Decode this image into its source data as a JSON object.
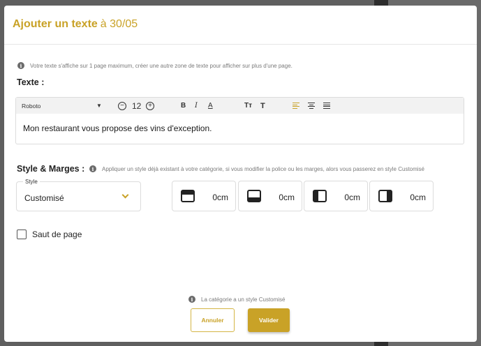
{
  "modal": {
    "title_bold": "Ajouter un texte",
    "title_date": "à 30/05"
  },
  "info_text": "Votre texte s'affiche sur 1 page maximum, créer une autre zone de texte pour afficher sur plus d'une page.",
  "texte_label": "Texte :",
  "toolbar": {
    "font": "Roboto",
    "font_size": "12",
    "bold": "B",
    "italic": "I",
    "underline": "A",
    "tt": "Tт",
    "t": "T"
  },
  "editor_content": "Mon restaurant vous propose des vins d'exception.",
  "style_section": {
    "label": "Style & Marges :",
    "hint": "Appliquer un style déjà existant à votre catégorie, si vous modifier la police ou les marges, alors vous passerez en style Customisé",
    "select_legend": "Style",
    "select_value": "Customisé"
  },
  "margins": {
    "top": "0cm",
    "bottom": "0cm",
    "left": "0cm",
    "right": "0cm"
  },
  "page_break_label": "Saut de page",
  "footer": {
    "note": "La catégorie a un style Customisé",
    "cancel_label": "Annuler",
    "validate_label": "Valider"
  },
  "colors": {
    "accent": "#c9a227"
  }
}
